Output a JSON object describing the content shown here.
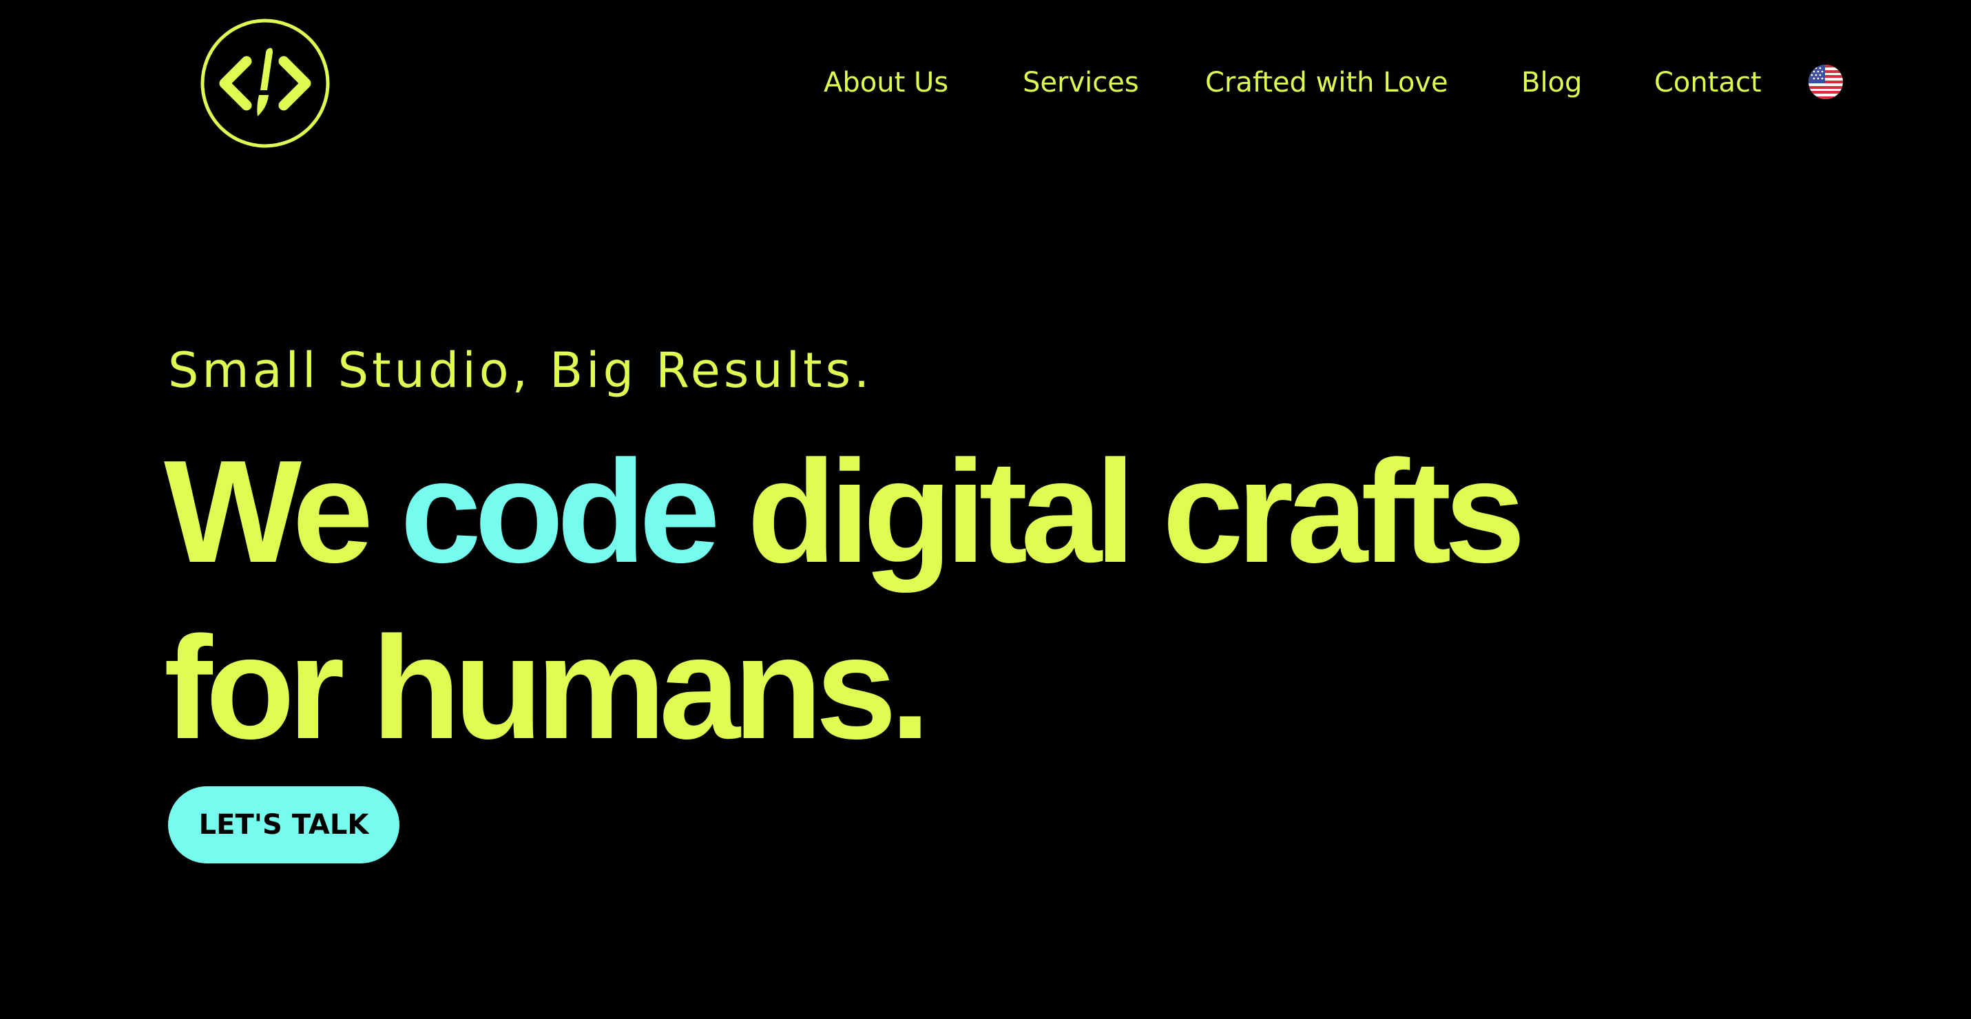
{
  "logo": {
    "icon": "code-brush-icon",
    "color": "#e2fb52"
  },
  "nav": {
    "items": [
      {
        "label": "About Us"
      },
      {
        "label": "Services"
      },
      {
        "label": "Crafted with Love"
      },
      {
        "label": "Blog"
      },
      {
        "label": "Contact"
      }
    ],
    "language_icon": "us-flag-icon"
  },
  "hero": {
    "tagline": "Small Studio, Big Results.",
    "headline": {
      "word1": "We",
      "word2": "code",
      "word3": "digital crafts",
      "line2": "for humans."
    },
    "cta_label": "LET'S TALK"
  },
  "colors": {
    "background": "#000000",
    "primary": "#e2fb52",
    "accent": "#76fcef",
    "cta_text": "#000000"
  }
}
